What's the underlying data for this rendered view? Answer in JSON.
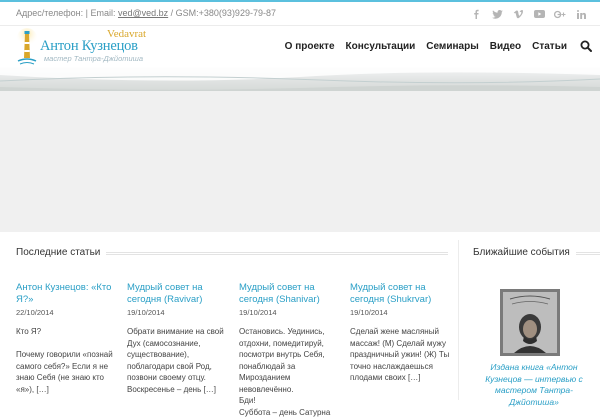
{
  "topbar": {
    "contacts_prefix": "Адрес/телефон:  |  Email: ",
    "email": "ved@ved.bz",
    "contacts_suffix": " / GSM:+380(93)929-79-87",
    "social_icons": [
      "facebook-icon",
      "twitter-icon",
      "vimeo-icon",
      "youtube-icon",
      "google-plus-icon",
      "linkedin-icon"
    ]
  },
  "logo": {
    "brand": "Vedavrat",
    "name": "Антон Кузнецов",
    "tagline": "мастер Тантра-Джйотиша"
  },
  "nav": {
    "items": [
      "О проекте",
      "Консультации",
      "Семинары",
      "Видео",
      "Статьи"
    ]
  },
  "colors": {
    "accent": "#2a9fc6",
    "brand_gold": "#d9a72b",
    "top_strip": "#5bc0de"
  },
  "recent": {
    "heading": "Последние статьи",
    "posts": [
      {
        "title": "Антон Кузнецов: «Кто Я?»",
        "date": "22/10/2014",
        "excerpt": "Кто Я?\n\nПочему говорили «познай самого себя?» Если я не знаю Себя (не знаю кто «я»), […]"
      },
      {
        "title": "Мудрый совет на сегодня (Ravivar)",
        "date": "19/10/2014",
        "excerpt": "Обрати внимание на свой Дух (самосознание, существование), поблагодари свой Род, позвони своему отцу. Воскресенье – день […]"
      },
      {
        "title": "Мудрый совет на сегодня (Shanivar)",
        "date": "19/10/2014",
        "excerpt": "Остановись. Уединись, отдохни, помедитируй, посмотри внутрь Себя, понаблюдай за Мирозданием невовлечённо.\nБди!\nСуббота – день Сатурна"
      },
      {
        "title": "Мудрый совет на сегодня (Shukrvar)",
        "date": "19/10/2014",
        "excerpt": "Сделай жене масляный массаж! (М) Сделай мужу праздничный ужин! (Ж) Ты точно наслаждаешься плодами своих […]"
      }
    ]
  },
  "events": {
    "heading": "Ближайшие события",
    "caption": "Издана книга «Антон Кузнецов — интервью с мастером Тантра-Джйотиша»"
  }
}
